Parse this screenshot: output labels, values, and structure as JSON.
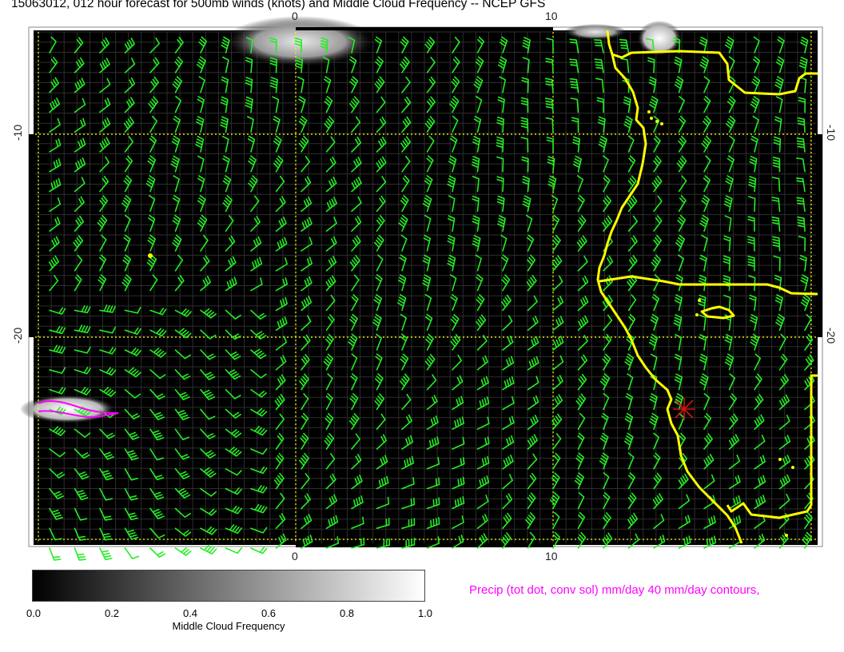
{
  "title": "15063012, 012 hour forecast for 500mb winds (knots) and Middle Cloud Frequency -- NCEP GFS",
  "axes": {
    "top_ticks": [
      "0",
      "10"
    ],
    "bottom_ticks": [
      "0",
      "10"
    ],
    "left_ticks": [
      "-10",
      "-20"
    ],
    "right_ticks": [
      "-10",
      "-20"
    ]
  },
  "colorbar": {
    "title": "Middle Cloud Frequency",
    "labels": [
      "0.0",
      "0.2",
      "0.4",
      "0.6",
      "0.8",
      "1.0"
    ]
  },
  "precip_note": "Precip (tot dot, conv sol) mm/day 40 mm/day contours,",
  "colors": {
    "wind_barbs": "#22ee22",
    "coastline": "#ffff00",
    "precip_contour": "#ff00ff",
    "station_marker": "#dd1111",
    "map_background": "#000000"
  }
}
